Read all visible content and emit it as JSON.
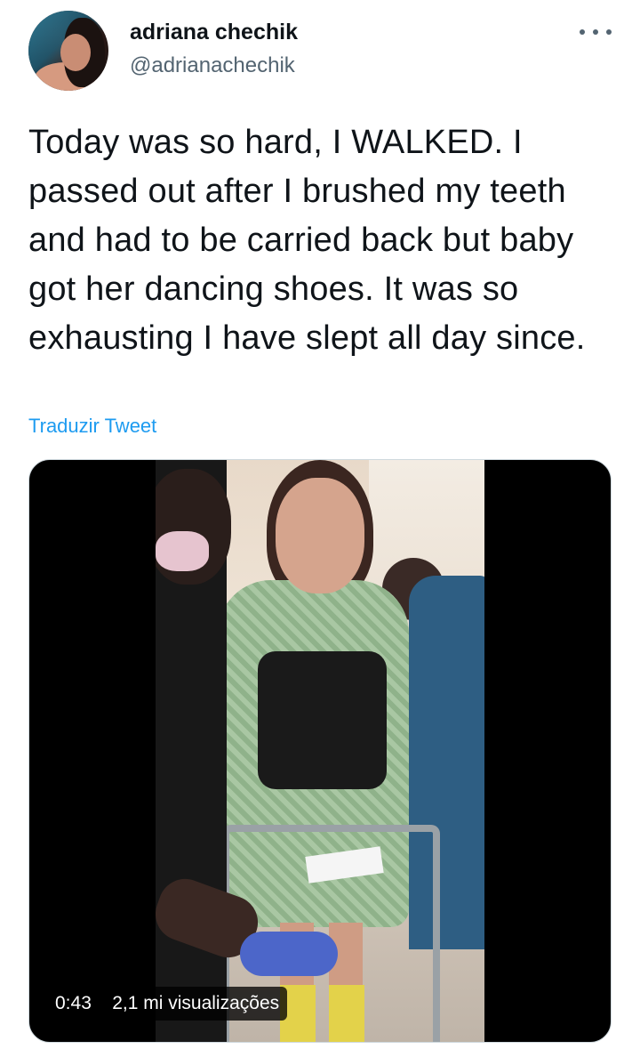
{
  "tweet": {
    "author": {
      "display_name": "adriana chechik",
      "handle": "@adrianachechik",
      "avatar_icon": "profile-photo"
    },
    "more_icon": "more-horizontal-icon",
    "text": "Today was so hard, I WALKED. I passed out after I brushed my teeth and had to be carried back but baby got her dancing shoes. It was so exhausting I have slept all day since.",
    "translate_label": "Traduzir Tweet",
    "media": {
      "type": "video",
      "duration": "0:43",
      "views": "2,1 mi visualizações"
    }
  },
  "colors": {
    "text_primary": "#0f1419",
    "text_secondary": "#536471",
    "link": "#1d9bf0",
    "media_border": "#cfd9de"
  }
}
